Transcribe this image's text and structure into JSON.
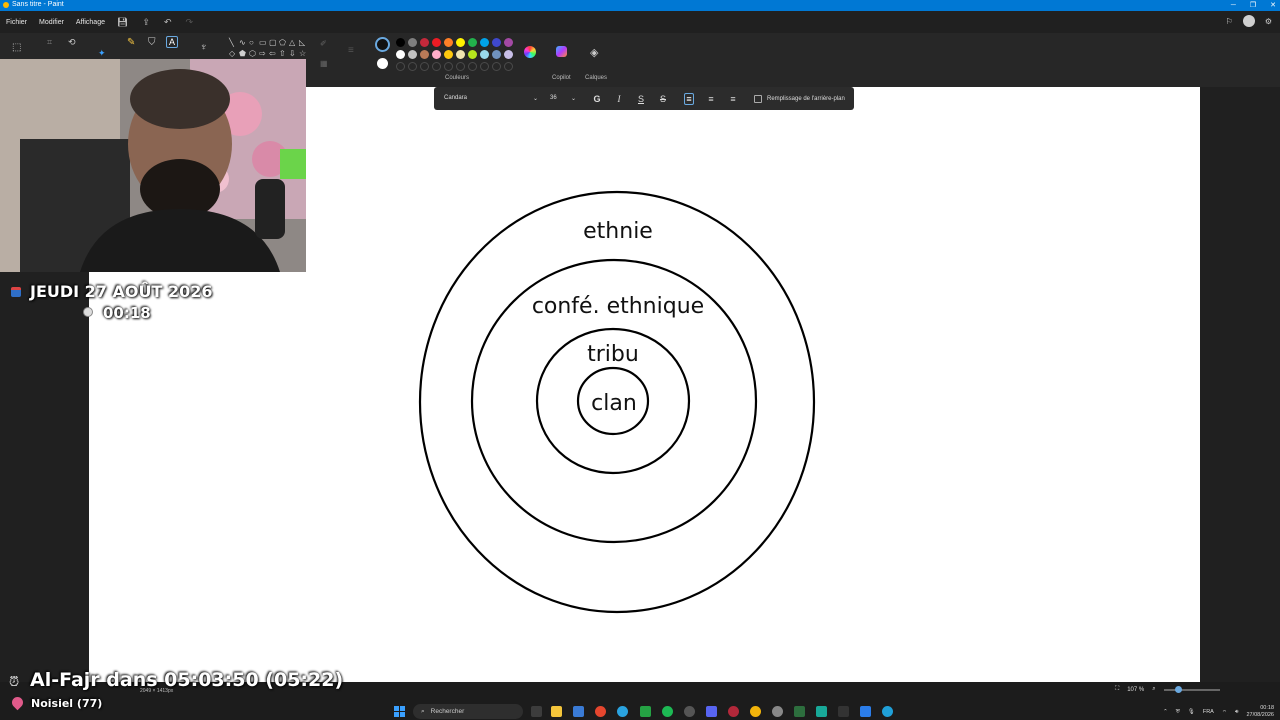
{
  "window": {
    "title": "Sans titre - Paint",
    "controls": [
      "─",
      "❐",
      "✕"
    ]
  },
  "menu": {
    "items": [
      "Fichier",
      "Modifier",
      "Affichage"
    ]
  },
  "ribbon": {
    "colors_label": "Couleurs",
    "copilot_label": "Copilot",
    "layers_label": "Calques",
    "palette_row1": [
      "#000000",
      "#7f7f7f",
      "#c3293b",
      "#ed1c24",
      "#ff7f27",
      "#fff200",
      "#22b14c",
      "#00a2e8",
      "#3f48cc",
      "#a349a4"
    ],
    "palette_row2": [
      "#ffffff",
      "#c3c3c3",
      "#b97a57",
      "#ffaec9",
      "#ffc90e",
      "#efe4b0",
      "#b5e61d",
      "#99d9ea",
      "#7092be",
      "#c8bfe7"
    ],
    "accent_color": "#6aa9e0"
  },
  "textbar": {
    "font": "Candara",
    "size": "36",
    "bold": "G",
    "italic": "I",
    "underline": "S",
    "strike": "S",
    "fill_label": "Remplissage de l'arrière-plan"
  },
  "diagram": {
    "labels": [
      "ethnie",
      "confé. ethnique",
      "tribu",
      "clan"
    ]
  },
  "overlay": {
    "date": "JEUDI 27 AOÛT 2026",
    "time": "00:18",
    "prayer": "Al-Fajr dans 05:03:50 (05:22)",
    "location": "Noisiel (77)"
  },
  "status": {
    "dimensions": "2049 × 1413px",
    "zoom": "107 %",
    "zoom_level": 0.2
  },
  "taskbar": {
    "search_placeholder": "Rechercher",
    "language": "FRA",
    "clock_time": "00:18",
    "clock_date": "27/08/2026"
  }
}
